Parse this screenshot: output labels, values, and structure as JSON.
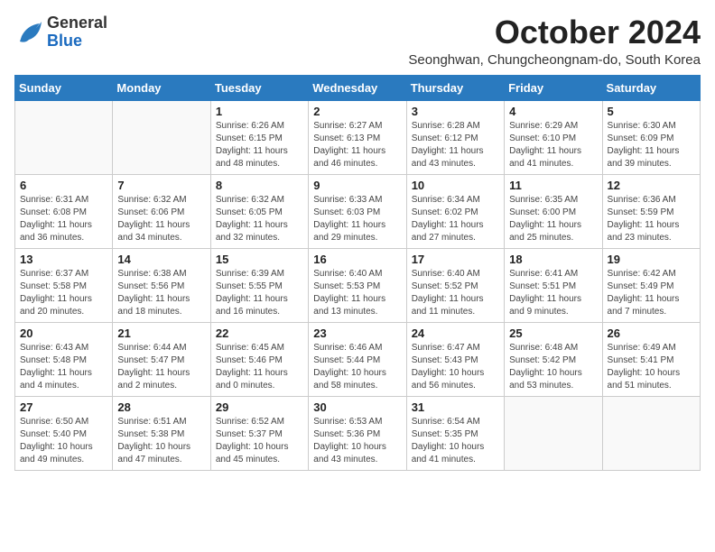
{
  "logo": {
    "general": "General",
    "blue": "Blue"
  },
  "title": "October 2024",
  "subtitle": "Seonghwan, Chungcheongnam-do, South Korea",
  "days_of_week": [
    "Sunday",
    "Monday",
    "Tuesday",
    "Wednesday",
    "Thursday",
    "Friday",
    "Saturday"
  ],
  "weeks": [
    [
      {
        "num": "",
        "info": ""
      },
      {
        "num": "",
        "info": ""
      },
      {
        "num": "1",
        "info": "Sunrise: 6:26 AM\nSunset: 6:15 PM\nDaylight: 11 hours and 48 minutes."
      },
      {
        "num": "2",
        "info": "Sunrise: 6:27 AM\nSunset: 6:13 PM\nDaylight: 11 hours and 46 minutes."
      },
      {
        "num": "3",
        "info": "Sunrise: 6:28 AM\nSunset: 6:12 PM\nDaylight: 11 hours and 43 minutes."
      },
      {
        "num": "4",
        "info": "Sunrise: 6:29 AM\nSunset: 6:10 PM\nDaylight: 11 hours and 41 minutes."
      },
      {
        "num": "5",
        "info": "Sunrise: 6:30 AM\nSunset: 6:09 PM\nDaylight: 11 hours and 39 minutes."
      }
    ],
    [
      {
        "num": "6",
        "info": "Sunrise: 6:31 AM\nSunset: 6:08 PM\nDaylight: 11 hours and 36 minutes."
      },
      {
        "num": "7",
        "info": "Sunrise: 6:32 AM\nSunset: 6:06 PM\nDaylight: 11 hours and 34 minutes."
      },
      {
        "num": "8",
        "info": "Sunrise: 6:32 AM\nSunset: 6:05 PM\nDaylight: 11 hours and 32 minutes."
      },
      {
        "num": "9",
        "info": "Sunrise: 6:33 AM\nSunset: 6:03 PM\nDaylight: 11 hours and 29 minutes."
      },
      {
        "num": "10",
        "info": "Sunrise: 6:34 AM\nSunset: 6:02 PM\nDaylight: 11 hours and 27 minutes."
      },
      {
        "num": "11",
        "info": "Sunrise: 6:35 AM\nSunset: 6:00 PM\nDaylight: 11 hours and 25 minutes."
      },
      {
        "num": "12",
        "info": "Sunrise: 6:36 AM\nSunset: 5:59 PM\nDaylight: 11 hours and 23 minutes."
      }
    ],
    [
      {
        "num": "13",
        "info": "Sunrise: 6:37 AM\nSunset: 5:58 PM\nDaylight: 11 hours and 20 minutes."
      },
      {
        "num": "14",
        "info": "Sunrise: 6:38 AM\nSunset: 5:56 PM\nDaylight: 11 hours and 18 minutes."
      },
      {
        "num": "15",
        "info": "Sunrise: 6:39 AM\nSunset: 5:55 PM\nDaylight: 11 hours and 16 minutes."
      },
      {
        "num": "16",
        "info": "Sunrise: 6:40 AM\nSunset: 5:53 PM\nDaylight: 11 hours and 13 minutes."
      },
      {
        "num": "17",
        "info": "Sunrise: 6:40 AM\nSunset: 5:52 PM\nDaylight: 11 hours and 11 minutes."
      },
      {
        "num": "18",
        "info": "Sunrise: 6:41 AM\nSunset: 5:51 PM\nDaylight: 11 hours and 9 minutes."
      },
      {
        "num": "19",
        "info": "Sunrise: 6:42 AM\nSunset: 5:49 PM\nDaylight: 11 hours and 7 minutes."
      }
    ],
    [
      {
        "num": "20",
        "info": "Sunrise: 6:43 AM\nSunset: 5:48 PM\nDaylight: 11 hours and 4 minutes."
      },
      {
        "num": "21",
        "info": "Sunrise: 6:44 AM\nSunset: 5:47 PM\nDaylight: 11 hours and 2 minutes."
      },
      {
        "num": "22",
        "info": "Sunrise: 6:45 AM\nSunset: 5:46 PM\nDaylight: 11 hours and 0 minutes."
      },
      {
        "num": "23",
        "info": "Sunrise: 6:46 AM\nSunset: 5:44 PM\nDaylight: 10 hours and 58 minutes."
      },
      {
        "num": "24",
        "info": "Sunrise: 6:47 AM\nSunset: 5:43 PM\nDaylight: 10 hours and 56 minutes."
      },
      {
        "num": "25",
        "info": "Sunrise: 6:48 AM\nSunset: 5:42 PM\nDaylight: 10 hours and 53 minutes."
      },
      {
        "num": "26",
        "info": "Sunrise: 6:49 AM\nSunset: 5:41 PM\nDaylight: 10 hours and 51 minutes."
      }
    ],
    [
      {
        "num": "27",
        "info": "Sunrise: 6:50 AM\nSunset: 5:40 PM\nDaylight: 10 hours and 49 minutes."
      },
      {
        "num": "28",
        "info": "Sunrise: 6:51 AM\nSunset: 5:38 PM\nDaylight: 10 hours and 47 minutes."
      },
      {
        "num": "29",
        "info": "Sunrise: 6:52 AM\nSunset: 5:37 PM\nDaylight: 10 hours and 45 minutes."
      },
      {
        "num": "30",
        "info": "Sunrise: 6:53 AM\nSunset: 5:36 PM\nDaylight: 10 hours and 43 minutes."
      },
      {
        "num": "31",
        "info": "Sunrise: 6:54 AM\nSunset: 5:35 PM\nDaylight: 10 hours and 41 minutes."
      },
      {
        "num": "",
        "info": ""
      },
      {
        "num": "",
        "info": ""
      }
    ]
  ]
}
